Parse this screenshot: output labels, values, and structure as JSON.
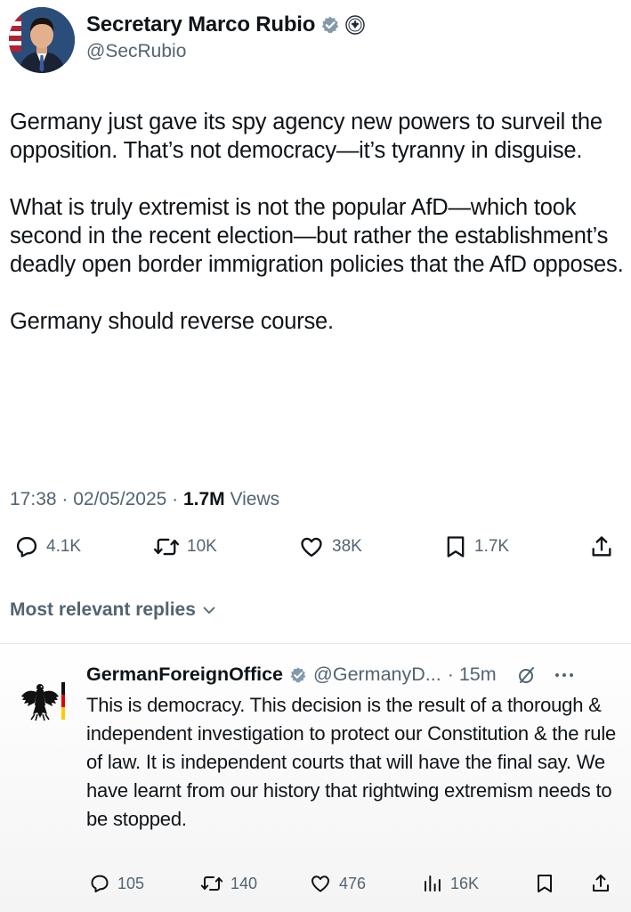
{
  "tweet": {
    "author": {
      "display_name": "Secretary Marco Rubio",
      "handle": "@SecRubio"
    },
    "paragraphs": [
      "Germany just gave its spy agency new powers to surveil the opposition.  That’s not democracy—it’s tyranny in disguise.",
      "What is truly extremist is not the popular AfD—which took second in the recent election—but rather the establishment’s deadly open border immigration policies that the AfD opposes.",
      "Germany should reverse course."
    ],
    "timestamp": "17:38 · 02/05/2025 · ",
    "views_count": "1.7M",
    "views_label": " Views",
    "stats": {
      "replies": "4.1K",
      "reposts": "10K",
      "likes": "38K",
      "bookmarks": "1.7K"
    }
  },
  "replies_sort_label": "Most relevant replies",
  "reply": {
    "display_name": "GermanForeignOffice",
    "handle": "@GermanyD...",
    "time": "· 15m",
    "text": "This is democracy. This decision is the result of a thorough & independent investigation to protect our Constitution & the rule of law. It is independent courts that will have the final say. We have learnt from our history that rightwing extremism needs to be stopped.",
    "stats": {
      "replies": "105",
      "reposts": "140",
      "likes": "476",
      "views": "16K"
    }
  },
  "colors": {
    "text_primary": "#0f1419",
    "text_secondary": "#536471",
    "verified_gray": "#829aab",
    "divider": "#e5e7ea"
  },
  "icons": {
    "reply": "speech-bubble-icon",
    "repost": "repost-arrows-icon",
    "like": "heart-icon",
    "bookmark": "bookmark-icon",
    "share": "share-upload-icon",
    "views": "bar-chart-icon",
    "grok": "grok-icon",
    "more": "more-dots-icon"
  }
}
